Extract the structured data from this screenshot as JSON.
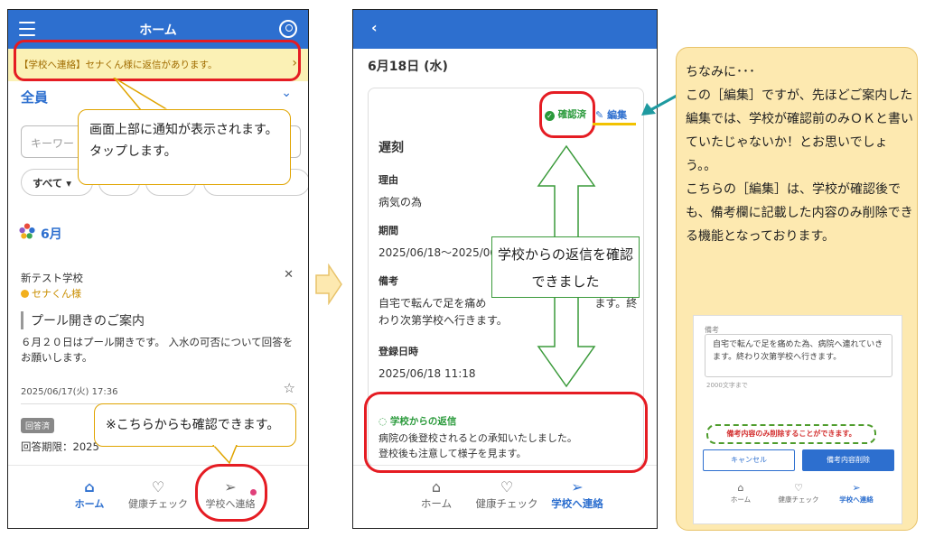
{
  "left_screen": {
    "header_title": "ホーム",
    "notice": "【学校へ連絡】セナくん様に返信があります。",
    "group": "全員",
    "search_placeholder": "キーワー",
    "filter_all": "すべて",
    "month": "6月",
    "message": {
      "school": "新テスト学校",
      "child": "セナくん様",
      "title": "プール開きのご案内",
      "body": "６月２０日はプール開きです。 入水の可否について回答をお願いします。",
      "date": "2025/06/17(火) 17:36",
      "badge": "回答済",
      "deadline": "回答期限：2025"
    },
    "nav": [
      "ホーム",
      "健康チェック",
      "学校へ連絡"
    ]
  },
  "callouts": {
    "top": "画面上部に通知が表示されます。タップします。",
    "bottom": "※こちらからも確認できます。",
    "reply": "学校からの返信を確認できました"
  },
  "right_screen": {
    "date": "6月18日 (水)",
    "confirmed": "確認済",
    "edit": "編集",
    "type": "遅刻",
    "reason_label": "理由",
    "reason": "病気の為",
    "period_label": "期間",
    "period": "2025/06/18〜2025/06",
    "note_label": "備考",
    "note": "自宅で転んで足を痛め　　　　　　　　　　ます。終わり次第学校へ行きます。",
    "registered_label": "登録日時",
    "registered": "2025/06/18 11:18",
    "reply_label": "学校からの返信",
    "reply_line1": "病院の後登校されるとの承知いたしました。",
    "reply_line2": "登校後も注意して様子を見ます。",
    "nav": [
      "ホーム",
      "健康チェック",
      "学校へ連絡"
    ]
  },
  "explain": {
    "lines": [
      "ちなみに･･･",
      "この［編集］ですが、先ほどご案内した編集では、学校が確認前のみＯＫと書いていたじゃないか！とお思いでしょう。。",
      "こちらの［編集］は、学校が確認後でも、備考欄に記載した内容のみ削除できる機能となっております。"
    ],
    "shot": {
      "note_label": "備考",
      "note_text": "自宅で転んで足を痛めた為、病院へ連れていきます。終わり次第学校へ行きます。",
      "count": "2000文字まで",
      "warning": "備考内容のみ削除することができます。",
      "cancel": "キャンセル",
      "delete": "備考内容削除",
      "nav": [
        "ホーム",
        "健康チェック",
        "学校へ連絡"
      ]
    }
  },
  "colors": {
    "primary": "#2d6fcf",
    "highlight_red": "#e51c23",
    "green": "#2a9a3b",
    "notice_bg": "#fbf1b5",
    "panel_bg": "#fde9b0"
  }
}
